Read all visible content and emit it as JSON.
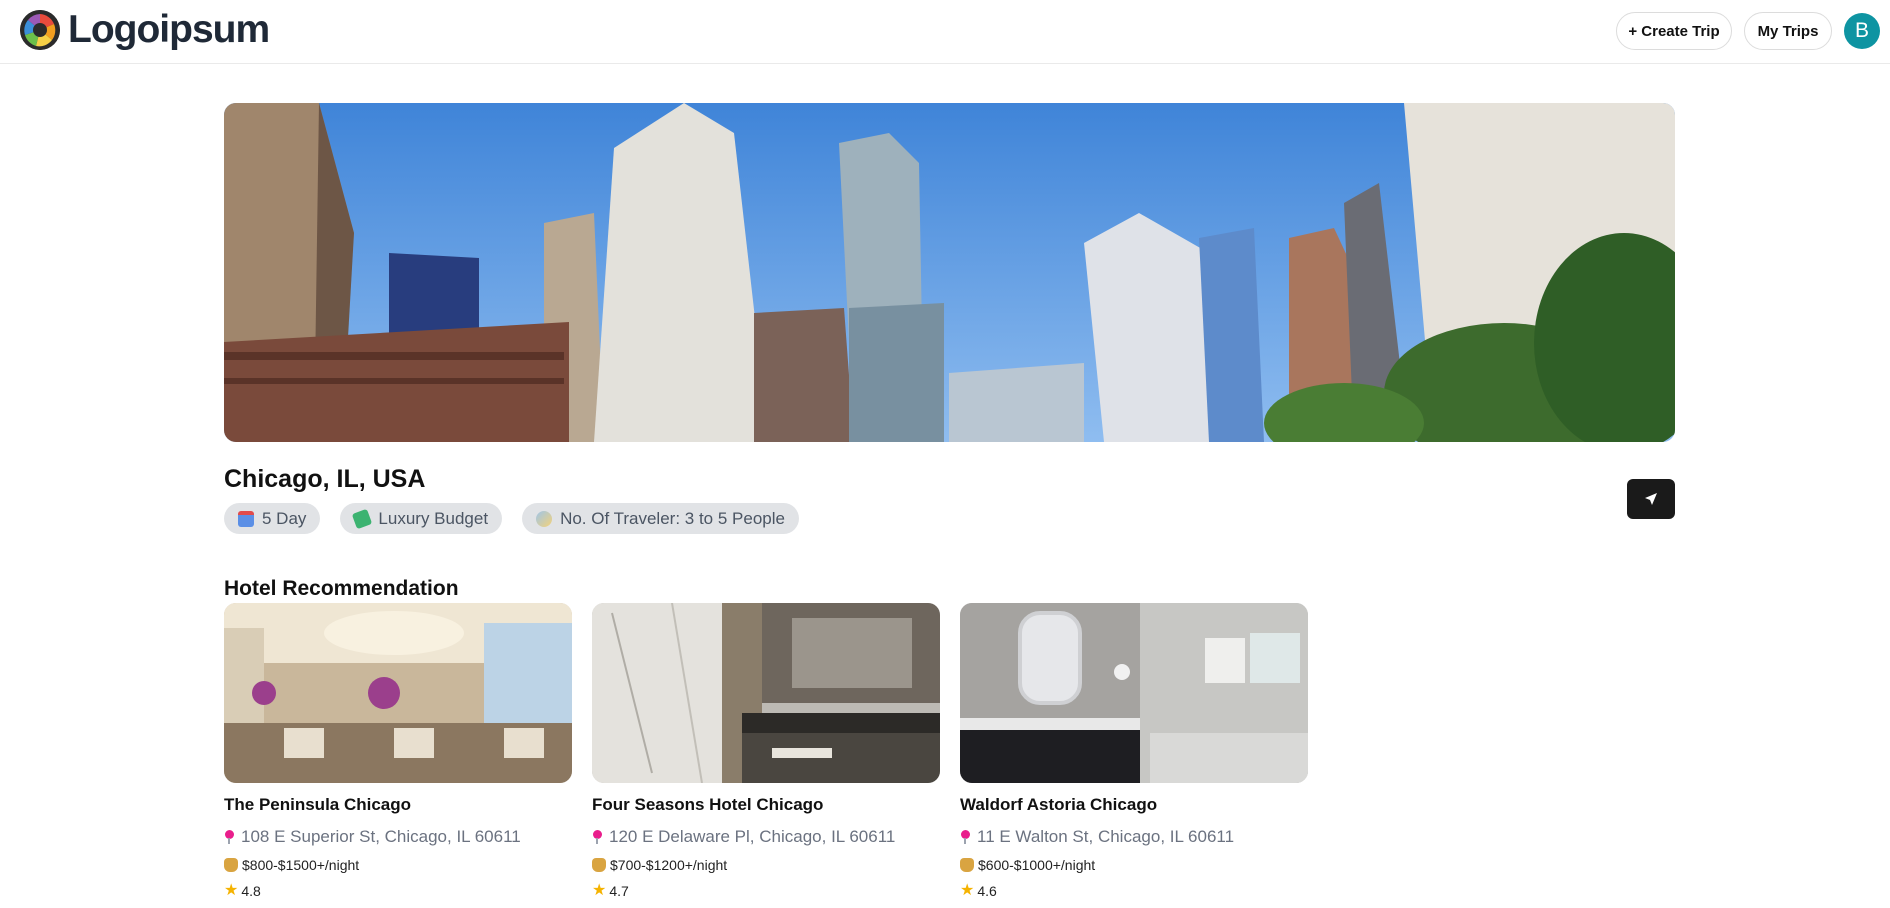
{
  "header": {
    "logo_text": "Logoipsum",
    "create_trip_label": "+ Create Trip",
    "my_trips_label": "My Trips",
    "avatar_initial": "B"
  },
  "trip": {
    "destination": "Chicago, IL, USA",
    "chips": [
      {
        "icon": "calendar-icon",
        "label": "5 Day"
      },
      {
        "icon": "money-icon",
        "label": "Luxury Budget"
      },
      {
        "icon": "travelers-icon",
        "label": "No. Of Traveler: 3 to 5 People"
      }
    ],
    "share_icon": "send-icon"
  },
  "hotels": {
    "section_title": "Hotel Recommendation",
    "items": [
      {
        "name": "The Peninsula Chicago",
        "address": "108 E Superior St, Chicago, IL 60611",
        "price": "$800-$1500+/night",
        "rating": "4.8"
      },
      {
        "name": "Four Seasons Hotel Chicago",
        "address": "120 E Delaware Pl, Chicago, IL 60611",
        "price": "$700-$1200+/night",
        "rating": "4.7"
      },
      {
        "name": "Waldorf Astoria Chicago",
        "address": "11 E Walton St, Chicago, IL 60611",
        "price": "$600-$1000+/night",
        "rating": "4.6"
      }
    ]
  },
  "colors": {
    "accent": "#0e94a2",
    "dark_button": "#1a1a1a",
    "chip_bg": "#e1e3e6",
    "pin": "#e91e8c",
    "star": "#f5b301"
  }
}
